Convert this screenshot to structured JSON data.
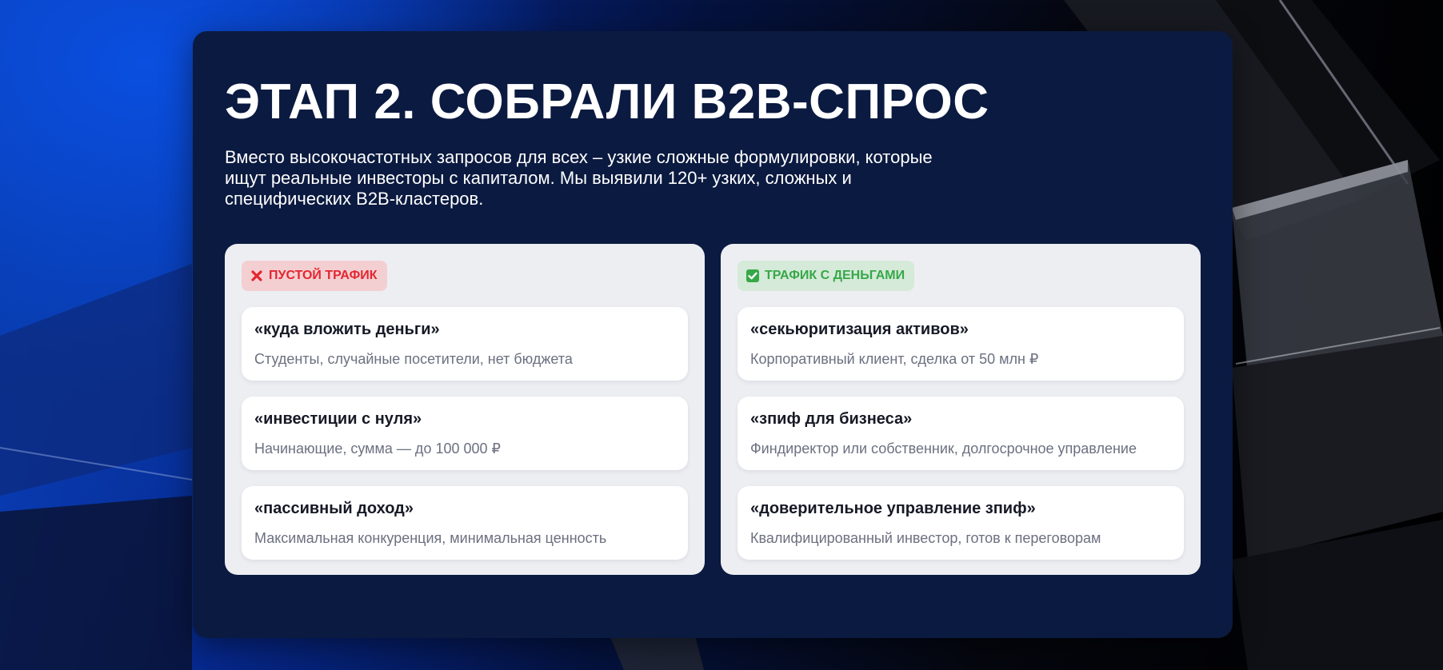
{
  "header": {
    "title": "ЭТАП 2. СОБРАЛИ В2В-СПРОС",
    "description": "Вместо высокочастотных запросов для всех – узкие сложные формулировки, которые ищут реальные инвесторы с капиталом. Мы выявили 120+ узких, сложных и специфических B2B-кластеров."
  },
  "columns": {
    "empty": {
      "badge": {
        "icon": "cross-icon",
        "label": "ПУСТОЙ ТРАФИК",
        "color": "#e3262f",
        "bg": "#f3cfd2"
      },
      "items": [
        {
          "query": "«куда вложить деньги»",
          "subtitle": "Студенты, случайные посетители, нет бюджета"
        },
        {
          "query": "«инвестиции с нуля»",
          "subtitle": "Начинающие, сумма — до 100 000 ₽"
        },
        {
          "query": "«пассивный доход»",
          "subtitle": "Максимальная конкуренция, минимальная ценность"
        }
      ]
    },
    "money": {
      "badge": {
        "icon": "check-icon",
        "label": "ТРАФИК С ДЕНЬГАМИ",
        "color": "#36a848",
        "bg": "#d5ead8"
      },
      "items": [
        {
          "query": "«секьюритизация активов»",
          "subtitle": "Корпоративный клиент, сделка от 50 млн ₽"
        },
        {
          "query": "«зпиф для бизнеса»",
          "subtitle": "Финдиректор или собственник, долгосрочное управление"
        },
        {
          "query": "«доверительное управление зпиф»",
          "subtitle": "Квалифицированный инвестор, готов к переговорам"
        }
      ]
    }
  },
  "colors": {
    "panel": "#0b1a40",
    "card": "#edeef2",
    "item": "#ffffff",
    "accent_blue": "#0a4fe0"
  }
}
